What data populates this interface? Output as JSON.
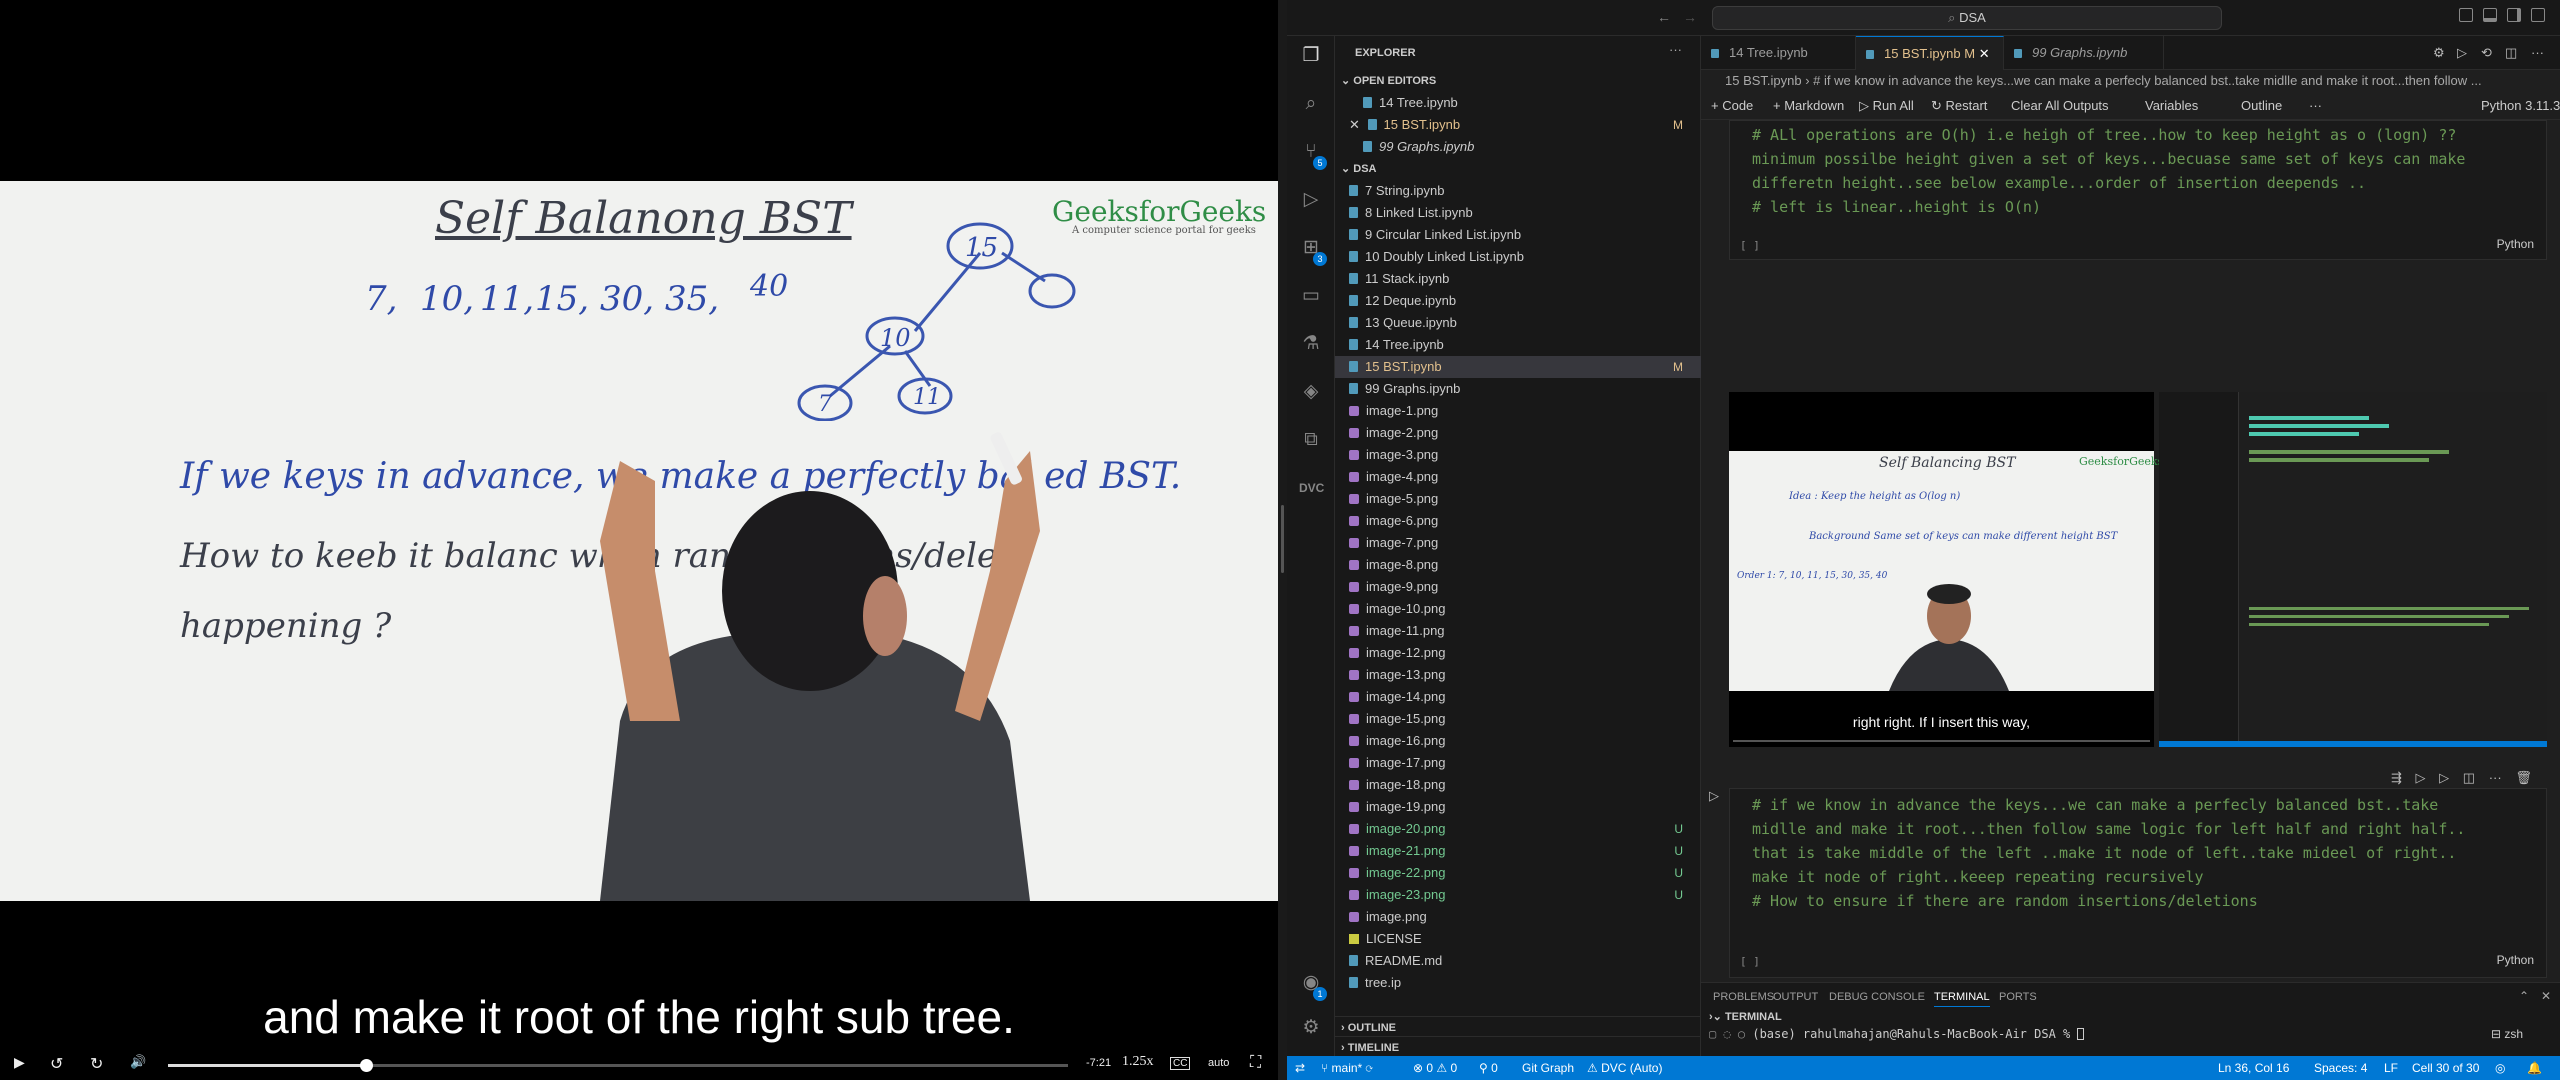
{
  "video": {
    "board": {
      "title": "Self  Balanong  BST",
      "keys": [
        "7,",
        "10,",
        "11,",
        "15,",
        "30,",
        "35,",
        "40"
      ],
      "tree_nodes": [
        "15",
        "10",
        "7",
        "11"
      ],
      "line1": "If  we  keys  in advance,  we    make  a  perfectly  bal    ed BST.",
      "line2": "How  to  keeb  it  balanc    when  ran      insertions/dele",
      "line3": "happening ?",
      "logo": "GeeksforGeeks",
      "logo_sub": "A computer science portal for geeks"
    },
    "caption": "and make it root of the right sub tree.",
    "controls": {
      "play": "▶",
      "rewind": "↺",
      "forward": "↻",
      "volume": "🔊",
      "time": "-7:21",
      "speed": "1.25x",
      "cc": "CC",
      "quality": "auto",
      "fullscreen": "⛶",
      "progress": 0.22
    }
  },
  "vscode": {
    "command_center": "DSA",
    "activity_badges": {
      "source_control": "5",
      "extensions": "3",
      "accounts": "1"
    },
    "explorer": {
      "title": "EXPLORER",
      "open_editors_label": "OPEN EDITORS",
      "open_editors": [
        {
          "name": "14 Tree.ipynb",
          "flag": "",
          "state": "normal"
        },
        {
          "name": "15 BST.ipynb",
          "flag": "M",
          "state": "modified"
        },
        {
          "name": "99 Graphs.ipynb",
          "flag": "",
          "state": "preview"
        }
      ],
      "folder_label": "DSA",
      "files": [
        {
          "name": "7 String.ipynb",
          "kind": "nb",
          "flag": "",
          "state": ""
        },
        {
          "name": "8 Linked List.ipynb",
          "kind": "nb",
          "flag": "",
          "state": ""
        },
        {
          "name": "9 Circular Linked List.ipynb",
          "kind": "nb",
          "flag": "",
          "state": ""
        },
        {
          "name": "10 Doubly Linked List.ipynb",
          "kind": "nb",
          "flag": "",
          "state": ""
        },
        {
          "name": "11 Stack.ipynb",
          "kind": "nb",
          "flag": "",
          "state": ""
        },
        {
          "name": "12 Deque.ipynb",
          "kind": "nb",
          "flag": "",
          "state": ""
        },
        {
          "name": "13 Queue.ipynb",
          "kind": "nb",
          "flag": "",
          "state": ""
        },
        {
          "name": "14 Tree.ipynb",
          "kind": "nb",
          "flag": "",
          "state": ""
        },
        {
          "name": "15 BST.ipynb",
          "kind": "nb",
          "flag": "M",
          "state": "mod"
        },
        {
          "name": "99 Graphs.ipynb",
          "kind": "nb",
          "flag": "",
          "state": ""
        },
        {
          "name": "image-1.png",
          "kind": "img",
          "flag": "",
          "state": ""
        },
        {
          "name": "image-2.png",
          "kind": "img",
          "flag": "",
          "state": ""
        },
        {
          "name": "image-3.png",
          "kind": "img",
          "flag": "",
          "state": ""
        },
        {
          "name": "image-4.png",
          "kind": "img",
          "flag": "",
          "state": ""
        },
        {
          "name": "image-5.png",
          "kind": "img",
          "flag": "",
          "state": ""
        },
        {
          "name": "image-6.png",
          "kind": "img",
          "flag": "",
          "state": ""
        },
        {
          "name": "image-7.png",
          "kind": "img",
          "flag": "",
          "state": ""
        },
        {
          "name": "image-8.png",
          "kind": "img",
          "flag": "",
          "state": ""
        },
        {
          "name": "image-9.png",
          "kind": "img",
          "flag": "",
          "state": ""
        },
        {
          "name": "image-10.png",
          "kind": "img",
          "flag": "",
          "state": ""
        },
        {
          "name": "image-11.png",
          "kind": "img",
          "flag": "",
          "state": ""
        },
        {
          "name": "image-12.png",
          "kind": "img",
          "flag": "",
          "state": ""
        },
        {
          "name": "image-13.png",
          "kind": "img",
          "flag": "",
          "state": ""
        },
        {
          "name": "image-14.png",
          "kind": "img",
          "flag": "",
          "state": ""
        },
        {
          "name": "image-15.png",
          "kind": "img",
          "flag": "",
          "state": ""
        },
        {
          "name": "image-16.png",
          "kind": "img",
          "flag": "",
          "state": ""
        },
        {
          "name": "image-17.png",
          "kind": "img",
          "flag": "",
          "state": ""
        },
        {
          "name": "image-18.png",
          "kind": "img",
          "flag": "",
          "state": ""
        },
        {
          "name": "image-19.png",
          "kind": "img",
          "flag": "",
          "state": ""
        },
        {
          "name": "image-20.png",
          "kind": "img",
          "flag": "U",
          "state": "new"
        },
        {
          "name": "image-21.png",
          "kind": "img",
          "flag": "U",
          "state": "new"
        },
        {
          "name": "image-22.png",
          "kind": "img",
          "flag": "U",
          "state": "new"
        },
        {
          "name": "image-23.png",
          "kind": "img",
          "flag": "U",
          "state": "new"
        },
        {
          "name": "image.png",
          "kind": "img",
          "flag": "",
          "state": ""
        },
        {
          "name": "LICENSE",
          "kind": "lic",
          "flag": "",
          "state": ""
        },
        {
          "name": "README.md",
          "kind": "md",
          "flag": "",
          "state": ""
        },
        {
          "name": "tree.ip",
          "kind": "nb",
          "flag": "",
          "state": ""
        }
      ],
      "outline_label": "OUTLINE",
      "timeline_label": "TIMELINE"
    },
    "tabs": [
      {
        "name": "14 Tree.ipynb",
        "flag": ""
      },
      {
        "name": "15 BST.ipynb",
        "flag": "M"
      },
      {
        "name": "99 Graphs.ipynb",
        "flag": ""
      }
    ],
    "breadcrumb": "15 BST.ipynb  ›  # if we know in advance the keys...we can make a perfecly balanced bst..take midlle and make it root...then follow ...",
    "toolbar": {
      "code": "+ Code",
      "markdown": "+ Markdown",
      "run_all": "▷ Run All",
      "restart": "↻ Restart",
      "clear": "Clear All Outputs",
      "variables": "Variables",
      "outline": "Outline",
      "more": "···",
      "kernel": "Python 3.11.3"
    },
    "cell1": {
      "lines": [
        "# ALl operations are O(h) i.e heigh of tree..how to keep height as o (logn) ??",
        "minimum possilbe height given a set of keys...becuase same set of keys can make",
        "differetn height..see below example...order of insertion deepends ..",
        "",
        "# left is linear..height is O(n)"
      ],
      "bracket": "[ ]",
      "lang": "Python"
    },
    "output": {
      "subtitle": "right right. If I insert this way,",
      "logo": "GeeksforGeeks",
      "board_lines": [
        "Self Balancing BST",
        "Idea :  Keep the height as O(log n)",
        "Background  Same set of keys can make  different height BST",
        "Order 1: 7, 10, 11, 15, 30, 35, 40"
      ]
    },
    "cell2": {
      "lines": [
        "# if we know in advance the keys...we can make a perfecly balanced bst..take",
        "midlle and make it root...then follow same logic for left half and right half..",
        "that is take middle of the left ..make it node of left..take mideel of right..",
        "make it node of right..keeep repeating recursively",
        "",
        "# How to ensure if there are random insertions/deletions"
      ],
      "bracket": "[ ]",
      "lang": "Python"
    },
    "panel": {
      "tabs": [
        "PROBLEMS",
        "OUTPUT",
        "DEBUG CONSOLE",
        "TERMINAL",
        "PORTS"
      ],
      "active": "TERMINAL",
      "section": "TERMINAL",
      "prompt": "(base) rahulmahajan@Rahuls-MacBook-Air DSA % ",
      "shell": "zsh"
    },
    "status": {
      "branch": "main*",
      "sync": "⟳",
      "errors": "⊗ 0 ⚠ 0",
      "ports": "⚲ 0",
      "git_graph": "Git Graph",
      "dvc": "DVC (Auto)",
      "position": "Ln 36, Col 16",
      "spaces": "Spaces: 4",
      "eol": "LF",
      "cell": "Cell 30 of 30"
    },
    "colors": {
      "accent": "#0078d4",
      "comment": "#6a9955",
      "modified": "#e2c08d",
      "untracked": "#73c991"
    }
  }
}
